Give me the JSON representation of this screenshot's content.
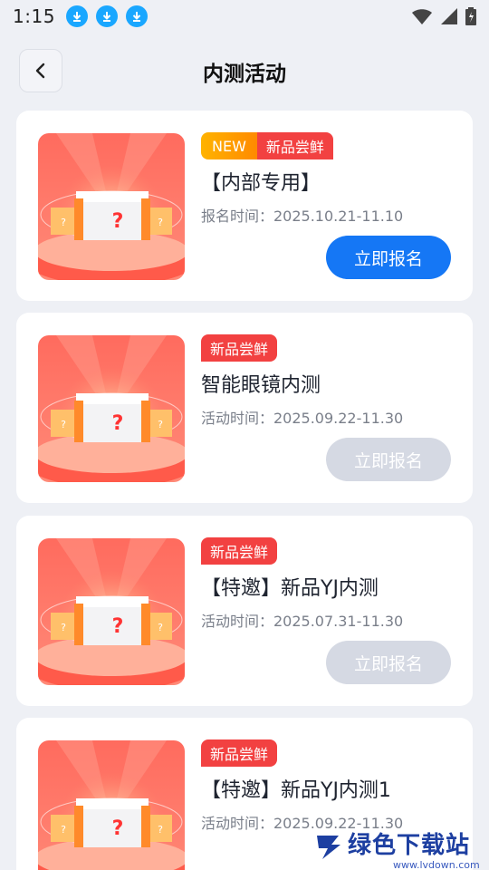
{
  "status_bar": {
    "time": "1:15",
    "icons": [
      "download-icon",
      "download-icon",
      "download-icon",
      "wifi-icon",
      "signal-icon",
      "battery-icon"
    ]
  },
  "header": {
    "title": "内测活动",
    "back_icon": "chevron-left-icon"
  },
  "colors": {
    "primary": "#1577f5",
    "tag_red": "#f24141",
    "tag_orange": "#ff9a00",
    "disabled": "#d5d9e3",
    "background": "#eef0f5"
  },
  "activities": [
    {
      "new_tag": "NEW",
      "category": "新品尝鲜",
      "title": "【内部专用】",
      "date": "报名时间：2025.10.21-11.10",
      "button": "立即报名",
      "enabled": true
    },
    {
      "new_tag": "",
      "category": "新品尝鲜",
      "title": "智能眼镜内测",
      "date": "活动时间：2025.09.22-11.30",
      "button": "立即报名",
      "enabled": false
    },
    {
      "new_tag": "",
      "category": "新品尝鲜",
      "title": "【特邀】新品YJ内测",
      "date": "活动时间：2025.07.31-11.30",
      "button": "立即报名",
      "enabled": false
    },
    {
      "new_tag": "",
      "category": "新品尝鲜",
      "title": "【特邀】新品YJ内测1",
      "date": "活动时间：2025.09.22-11.30",
      "button": "",
      "enabled": false
    }
  ],
  "watermark": {
    "text": "绿色下载站",
    "url": "www.lvdown.com"
  }
}
